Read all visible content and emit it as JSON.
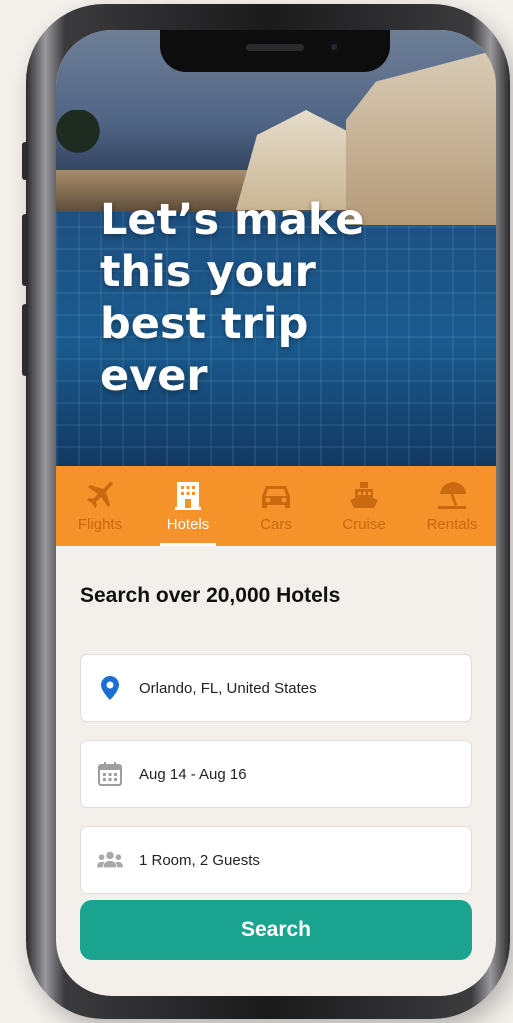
{
  "hero": {
    "headline": "Let’s make\nthis your\nbest trip\never"
  },
  "tabs": [
    {
      "label": "Flights",
      "icon": "plane-icon",
      "active": false
    },
    {
      "label": "Hotels",
      "icon": "hotel-icon",
      "active": true
    },
    {
      "label": "Cars",
      "icon": "car-icon",
      "active": false
    },
    {
      "label": "Cruise",
      "icon": "ship-icon",
      "active": false
    },
    {
      "label": "Rentals",
      "icon": "beach-umbrella-icon",
      "active": false
    }
  ],
  "search": {
    "heading": "Search over 20,000 Hotels",
    "location": "Orlando, FL, United States",
    "dates": "Aug 14 - Aug 16",
    "guests": "1 Room, 2 Guests",
    "button_label": "Search"
  },
  "colors": {
    "tab_bar": "#f6922a",
    "tab_inactive": "#c96a10",
    "accent_button": "#1aa48f",
    "location_pin": "#1a6fd1",
    "background": "#f3efea"
  }
}
